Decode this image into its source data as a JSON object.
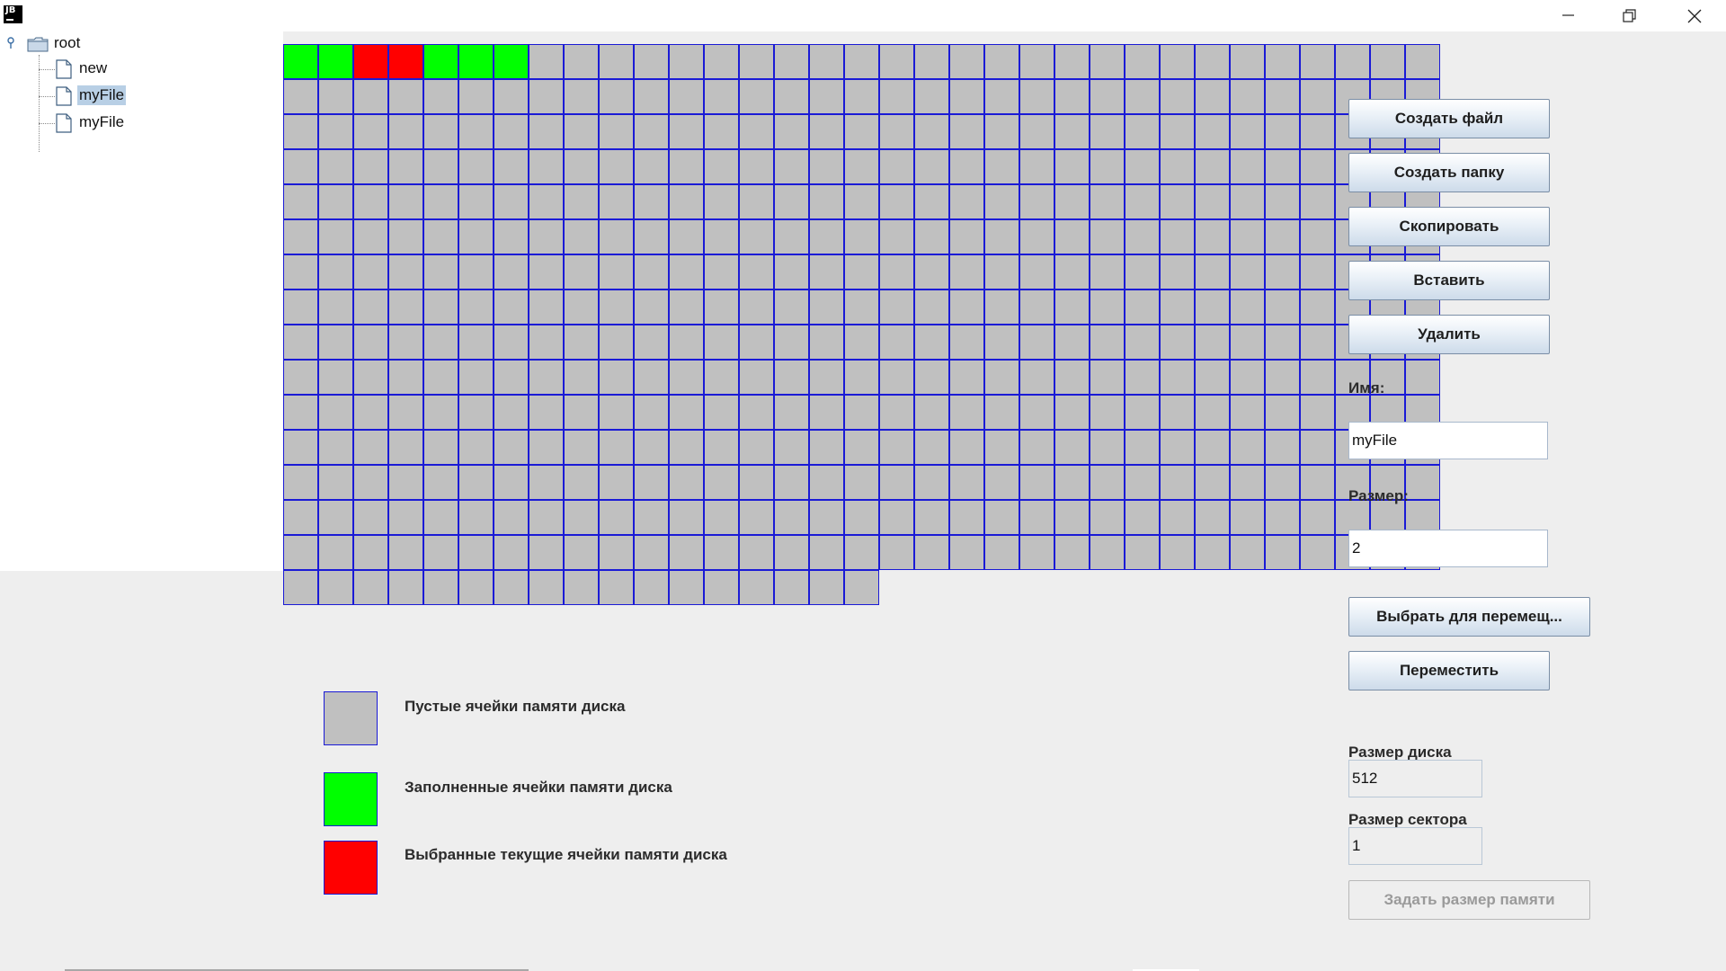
{
  "window": {
    "app_icon_text": "JB",
    "controls": {
      "minimize": "minimize-icon",
      "restore": "restore-icon",
      "close": "close-icon"
    }
  },
  "tree": {
    "root_label": "root",
    "children": [
      {
        "label": "new",
        "selected": false
      },
      {
        "label": "myFile",
        "selected": true
      },
      {
        "label": "myFile",
        "selected": false
      }
    ]
  },
  "disk": {
    "columns": 33,
    "full_rows": 15,
    "last_row_cells": 17,
    "colors": {
      "empty": "#c0c0c0",
      "filled": "#00ff00",
      "selected": "#ff0000",
      "border": "#1a1ad6"
    },
    "first_row_states": [
      "filled",
      "filled",
      "selected",
      "selected",
      "filled",
      "filled",
      "filled"
    ]
  },
  "actions": {
    "create_file": "Создать файл",
    "create_folder": "Создать папку",
    "copy": "Скопировать",
    "paste": "Вставить",
    "delete": "Удалить",
    "select_move": "Выбрать для перемещ...",
    "move": "Переместить",
    "set_memory": "Задать размер памяти"
  },
  "form": {
    "name_label": "Имя:",
    "name_value": "myFile",
    "size_label": "Размер:",
    "size_value": "2",
    "disk_size_label": "Размер диска",
    "disk_size_value": "512",
    "sector_size_label": "Размер сектора",
    "sector_size_value": "1"
  },
  "legend": [
    {
      "text": "Пустые ячейки памяти диска",
      "color": "#c0c0c0"
    },
    {
      "text": "Заполненные ячейки памяти диска",
      "color": "#00ff00"
    },
    {
      "text": "Выбранные текущие ячейки памяти диска",
      "color": "#ff0000"
    }
  ]
}
